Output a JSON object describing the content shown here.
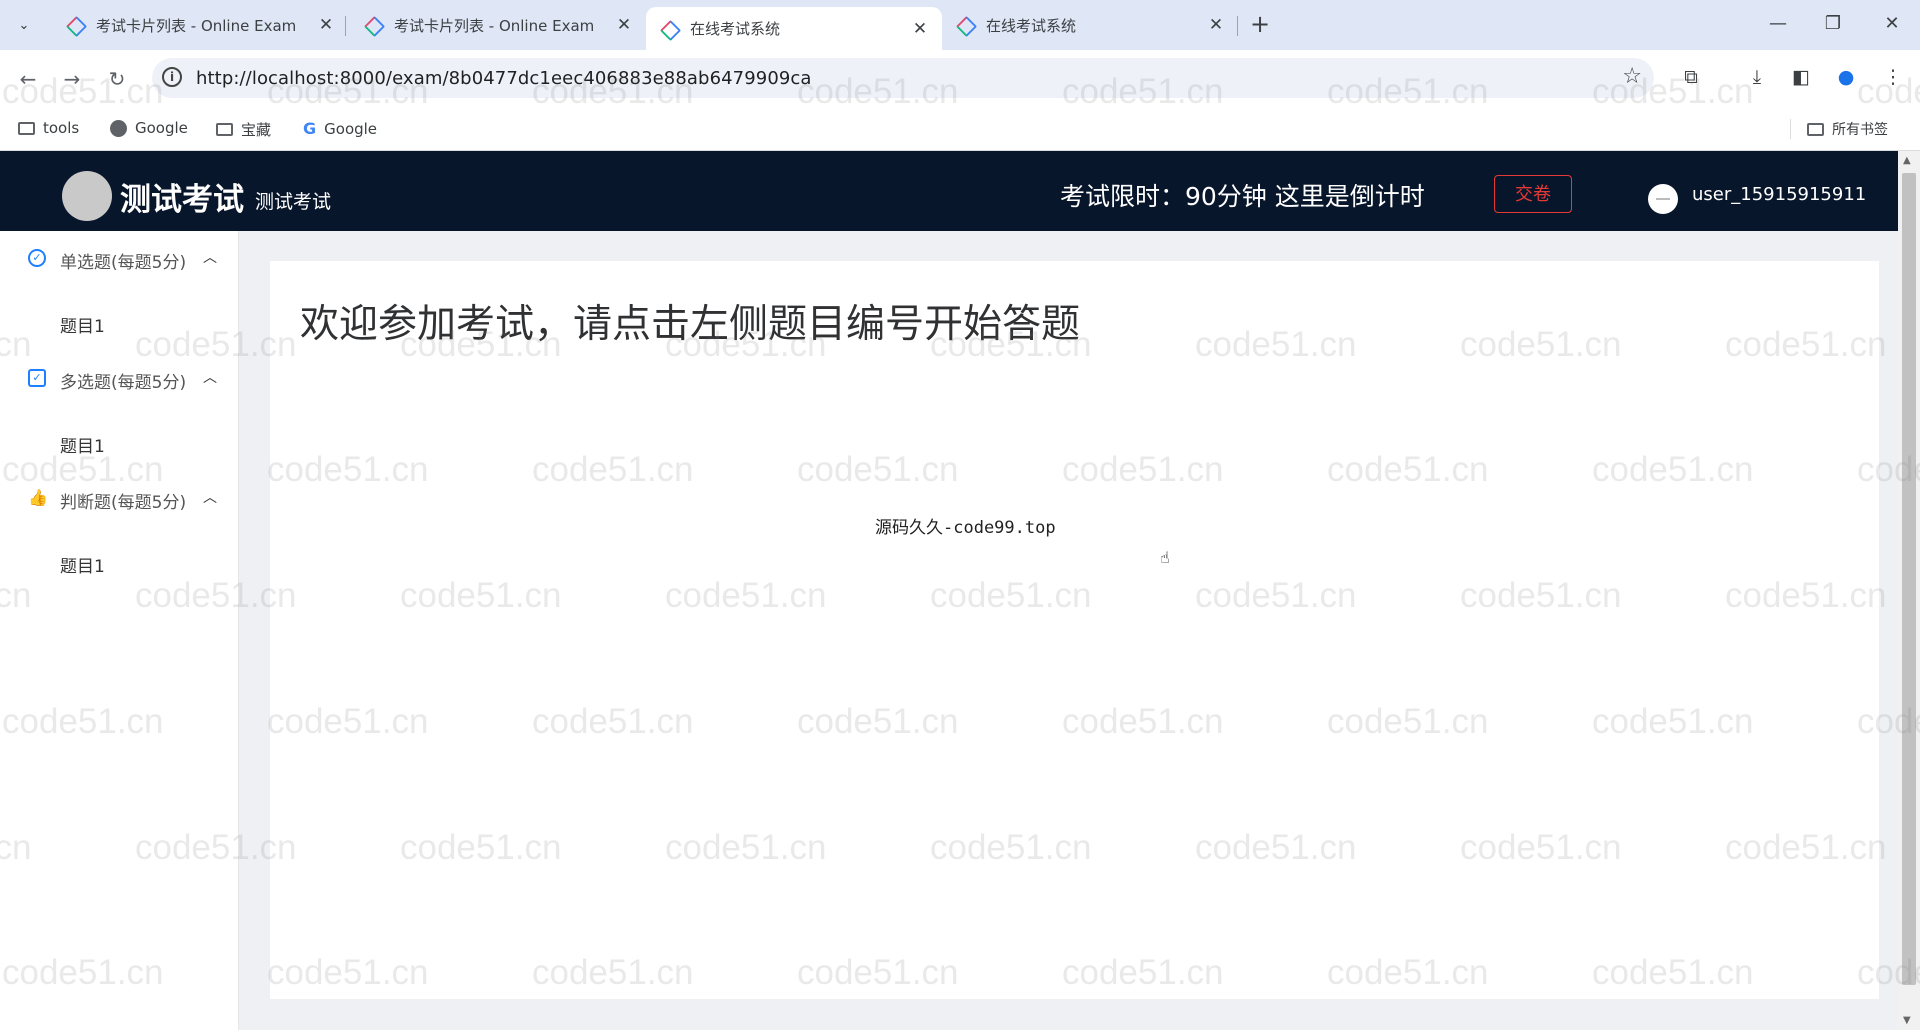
{
  "browser": {
    "tabs": [
      {
        "title": "考试卡片列表 - Online Exam",
        "active": false
      },
      {
        "title": "考试卡片列表 - Online Exam",
        "active": false
      },
      {
        "title": "在线考试系统",
        "active": true
      },
      {
        "title": "在线考试系统",
        "active": false
      }
    ],
    "url": "http://localhost:8000/exam/8b0477dc1eec406883e88ab6479909ca",
    "bookmarks": [
      {
        "label": "tools",
        "icon": "folder-icon"
      },
      {
        "label": "Google",
        "icon": "globe-icon"
      },
      {
        "label": "宝藏",
        "icon": "folder-icon"
      },
      {
        "label": "Google",
        "icon": "google-icon"
      }
    ],
    "all_bookmarks_label": "所有书签"
  },
  "header": {
    "title": "测试考试",
    "subtitle": "测试考试",
    "timer_text": "考试限时：90分钟 这里是倒计时",
    "submit_label": "交卷",
    "username": "user_15915915911"
  },
  "sidebar": {
    "groups": [
      {
        "label": "单选题(每题5分)",
        "icon": "check-circle-icon",
        "items": [
          "题目1"
        ]
      },
      {
        "label": "多选题(每题5分)",
        "icon": "check-square-icon",
        "items": [
          "题目1"
        ]
      },
      {
        "label": "判断题(每题5分)",
        "icon": "thumbs-up-icon",
        "items": [
          "题目1"
        ]
      }
    ]
  },
  "main": {
    "welcome": "欢迎参加考试，请点击左侧题目编号开始答题",
    "source_text": "源码久久-code99.top"
  },
  "watermark": "code51.cn",
  "colors": {
    "header_bg": "#08162b",
    "accent": "#1e80ff",
    "danger": "#e53935"
  }
}
